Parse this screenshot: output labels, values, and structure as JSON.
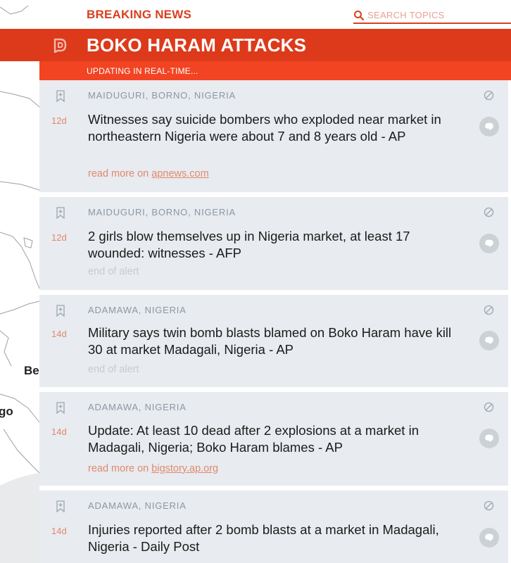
{
  "header": {
    "brand": "BREAKING NEWS",
    "search_placeholder": "SEARCH TOPICS",
    "title": "BOKO HARAM ATTACKS",
    "status": "UPDATING IN REAL-TIME..."
  },
  "map": {
    "labels": [
      "Be",
      "go"
    ]
  },
  "colors": {
    "accent": "#dc3a1b",
    "accent_light": "#f24422",
    "card_bg": "#e8ebef",
    "meta_text": "#8a97a5",
    "link_text": "#e0896e"
  },
  "alerts": [
    {
      "location": "MAIDUGURI, BORNO, NIGERIA",
      "age": "12d",
      "headline": "Witnesses say suicide bombers who exploded near market in northeastern Nigeria were about 7 and 8 years old - AP",
      "more_prefix": "read more on ",
      "more_link": "apnews.com"
    },
    {
      "location": "MAIDUGURI, BORNO, NIGERIA",
      "age": "12d",
      "headline": "2 girls blow themselves up in Nigeria market, at least 17 wounded: witnesses - AFP",
      "end_text": "end of alert"
    },
    {
      "location": "ADAMAWA, NIGERIA",
      "age": "14d",
      "headline": "Military says twin bomb blasts blamed on Boko Haram have kill 30 at market Madagali, Nigeria - AP",
      "end_text": "end of alert"
    },
    {
      "location": "ADAMAWA, NIGERIA",
      "age": "14d",
      "headline": "Update: At least 10 dead after 2 explosions at a market in Madagali, Nigeria; Boko Haram blames - AP",
      "more_prefix": "read more on ",
      "more_link": "bigstory.ap.org"
    },
    {
      "location": "ADAMAWA, NIGERIA",
      "age": "14d",
      "headline": "Injuries reported after 2 bomb blasts at a market in Madagali, Nigeria - Daily Post"
    }
  ]
}
